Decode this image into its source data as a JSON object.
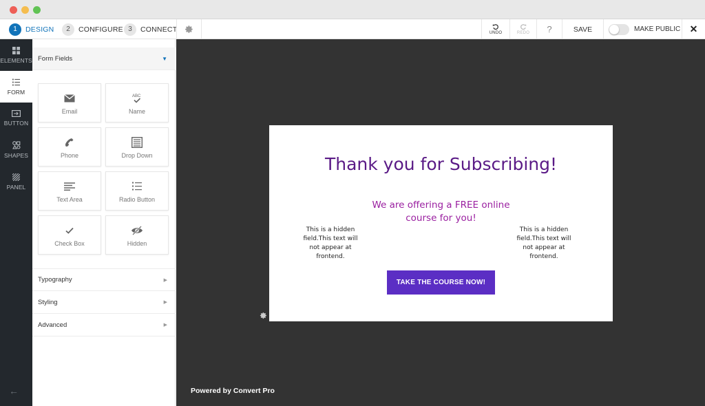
{
  "window": {
    "title": ""
  },
  "steps": [
    {
      "number": "1",
      "label": "DESIGN",
      "active": true
    },
    {
      "number": "2",
      "label": "CONFIGURE",
      "active": false
    },
    {
      "number": "3",
      "label": "CONNECT",
      "active": false
    }
  ],
  "toolbar": {
    "undo_label": "UNDO",
    "redo_label": "REDO",
    "help_label": "?",
    "save_label": "SAVE",
    "make_public_label": "MAKE PUBLIC",
    "make_public_on": false,
    "close_label": "✕"
  },
  "rail": {
    "items": [
      {
        "label": "ELEMENTS",
        "icon": "grid-icon",
        "active": false
      },
      {
        "label": "FORM",
        "icon": "list-icon",
        "active": true
      },
      {
        "label": "BUTTON",
        "icon": "button-icon",
        "active": false
      },
      {
        "label": "SHAPES",
        "icon": "shapes-icon",
        "active": false
      },
      {
        "label": "PANEL",
        "icon": "panel-icon",
        "active": false
      }
    ],
    "back_icon": "arrow-left-icon"
  },
  "panel": {
    "open_section": "Form Fields",
    "fields": [
      {
        "label": "Email",
        "icon": "envelope-icon"
      },
      {
        "label": "Name",
        "icon": "abc-check-icon"
      },
      {
        "label": "Phone",
        "icon": "phone-icon"
      },
      {
        "label": "Drop Down",
        "icon": "dropdown-list-icon"
      },
      {
        "label": "Text Area",
        "icon": "textarea-icon"
      },
      {
        "label": "Radio Button",
        "icon": "radio-list-icon"
      },
      {
        "label": "Check Box",
        "icon": "checkmark-icon"
      },
      {
        "label": "Hidden",
        "icon": "eye-slash-icon"
      }
    ],
    "sections": [
      "Typography",
      "Styling",
      "Advanced"
    ]
  },
  "canvas": {
    "popup": {
      "title": "Thank you for Subscribing!",
      "subtitle": "We are offering a FREE online course for you!",
      "hidden_note_left": "This is a hidden field.This text will not appear at frontend.",
      "hidden_note_right": "This is a hidden field.This text will not appear at frontend.",
      "button_label": "TAKE THE COURSE NOW!"
    },
    "powered_by": "Powered by Convert Pro"
  },
  "colors": {
    "accent_blue": "#1173b9",
    "rail_bg": "#23282d",
    "canvas_bg": "#333333",
    "title_purple": "#5a1a86",
    "subtitle_purple": "#9a1fa0",
    "cta_purple": "#5b2ec4"
  }
}
